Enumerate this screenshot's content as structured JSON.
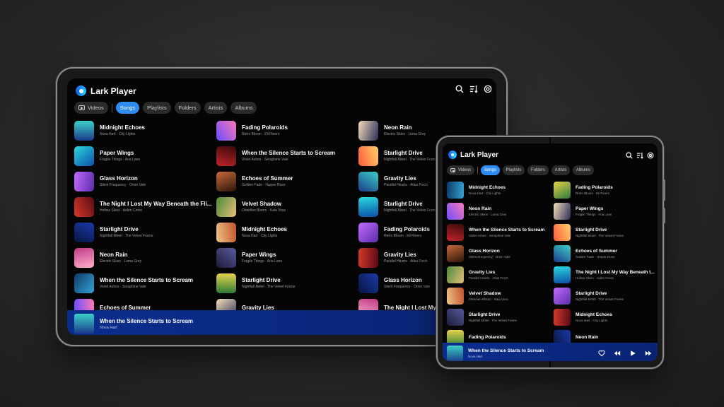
{
  "app": {
    "title": "Lark Player"
  },
  "tabs": [
    {
      "label": "Videos"
    },
    {
      "label": "Songs"
    },
    {
      "label": "Playlists"
    },
    {
      "label": "Folders"
    },
    {
      "label": "Artists"
    },
    {
      "label": "Albums"
    }
  ],
  "tablet": {
    "columns": [
      [
        {
          "title": "Midnight Echoes",
          "subtitle": "Nova Hart · City Lights"
        },
        {
          "title": "Paper Wings",
          "subtitle": "Fragile Things · Aria Lane"
        },
        {
          "title": "Glass Horizon",
          "subtitle": "Silent Frequency · Orion Vale"
        },
        {
          "title": "The Night I Lost My Way Beneath the Fli...",
          "subtitle": "Hollow Skies · Aiden Cross"
        },
        {
          "title": "Starlight Drive",
          "subtitle": "Nightfall Motel · The Velvet Frame"
        },
        {
          "title": "Neon Rain",
          "subtitle": "Electric Skies · Luma Grey"
        },
        {
          "title": "When the Silence Starts to Scream",
          "subtitle": "Violet Ashes · Seraphine Vale"
        },
        {
          "title": "Echoes of Summer",
          "subtitle": ""
        }
      ],
      [
        {
          "title": "Fading Polaroids",
          "subtitle": "Retro Bloom · Eli Rivers"
        },
        {
          "title": "When the Silence Starts to Scream",
          "subtitle": "Violet Ashes · Seraphine Vale"
        },
        {
          "title": "Echoes of Summer",
          "subtitle": "Golden Fade · Harper Rose"
        },
        {
          "title": "Velvet Shadow",
          "subtitle": "Obsidian Bloom · Kaia Voss"
        },
        {
          "title": "Midnight Echoes",
          "subtitle": "Nova Hart · City Lights"
        },
        {
          "title": "Paper Wings",
          "subtitle": "Fragile Things · Aria Lane"
        },
        {
          "title": "Starlight Drive",
          "subtitle": "Nightfall Motel · The Velvet Frame"
        },
        {
          "title": "Gravity Lies",
          "subtitle": ""
        }
      ],
      [
        {
          "title": "Neon Rain",
          "subtitle": "Electric Skies · Luma Grey"
        },
        {
          "title": "Starlight Drive",
          "subtitle": "Nightfall Motel · The Velvet Frame"
        },
        {
          "title": "Gravity Lies",
          "subtitle": "Parallel Hearts · Atlas Finch"
        },
        {
          "title": "Starlight Drive",
          "subtitle": "Nightfall Motel · The Velvet Frame"
        },
        {
          "title": "Fading Polaroids",
          "subtitle": "Retro Bloom · Eli Rivers"
        },
        {
          "title": "Gravity Lies",
          "subtitle": "Parallel Hearts · Atlas Finch"
        },
        {
          "title": "Glass Horizon",
          "subtitle": "Silent Frequency · Orion Vale"
        },
        {
          "title": "The Night I Lost My W...",
          "subtitle": ""
        }
      ]
    ],
    "now_playing": {
      "title": "When the Silence Starts to Scream",
      "subtitle": "Nova Hart"
    }
  },
  "phone": {
    "columns": [
      [
        {
          "title": "Midnight Echoes",
          "subtitle": "Nova Hart · City Lights"
        },
        {
          "title": "Neon Rain",
          "subtitle": "Electric Skies · Luma Grey"
        },
        {
          "title": "When the Silence Starts to Scream",
          "subtitle": "Violet Ashes · Seraphine Vale"
        },
        {
          "title": "Glass Horizon",
          "subtitle": "Silent Frequency · Orion Vale"
        },
        {
          "title": "Gravity Lies",
          "subtitle": "Parallel Hearts · Atlas Finch"
        },
        {
          "title": "Velvet Shadow",
          "subtitle": "Obsidian Bloom · Kaia Voss"
        },
        {
          "title": "Starlight Drive",
          "subtitle": "Nightfall Motel · The Velvet Frame"
        },
        {
          "title": "Fading Polaroids",
          "subtitle": ""
        }
      ],
      [
        {
          "title": "Fading Polaroids",
          "subtitle": "Retro Bloom · Eli Rivers"
        },
        {
          "title": "Paper Wings",
          "subtitle": "Fragile Things · Aria Lane"
        },
        {
          "title": "Starlight Drive",
          "subtitle": "Nightfall Motel · The Velvet Frame"
        },
        {
          "title": "Echoes of Summer",
          "subtitle": "Golden Fade · Harper Rose"
        },
        {
          "title": "The Night I Lost My Way Beneath t...",
          "subtitle": "Hollow Skies · Aiden Cross"
        },
        {
          "title": "Starlight Drive",
          "subtitle": "Nightfall Motel · The Velvet Frame"
        },
        {
          "title": "Midnight Echoes",
          "subtitle": "Nova Hart · City Lights"
        },
        {
          "title": "Neon Rain",
          "subtitle": ""
        }
      ]
    ],
    "now_playing": {
      "title": "When the Silence Starts to Scream",
      "subtitle": "Nova Hart"
    }
  },
  "icons": {
    "search": "search-icon",
    "sort": "sort-icon",
    "settings": "settings-icon",
    "heart": "heart-icon",
    "previous": "previous-icon",
    "play": "play-icon",
    "next": "next-icon",
    "video": "video-icon"
  },
  "colors": {
    "accent": "#2f8cf0",
    "player_bar": "#0b2d8c",
    "background": "#050505"
  },
  "art_palettes": [
    "#1b3a8a,#3bd1c8",
    "#f0c58a,#c0522a",
    "#0d3b66,#35a3d6",
    "#2bd8e0,#0c4ea8",
    "#5a5a9e,#1b1b3a",
    "#ff7ab8,#6a4cff",
    "#5b2ca8,#c26bff",
    "#2a7a3a,#e8d24a",
    "#c0242a,#3a0a0a",
    "#d63a2a,#5a0a14",
    "#f6e0b8,#2a2a5a",
    "#c86a3a,#2a1408",
    "#1a3aa8,#0a1440",
    "#ffd06a,#ff5a3a",
    "#e8c07a,#4a8a3a",
    "#ffb0c8,#c03a8a"
  ]
}
